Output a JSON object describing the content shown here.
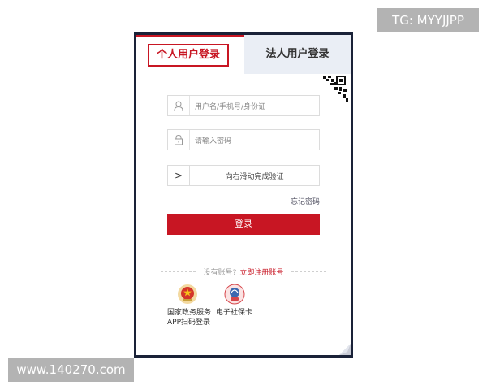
{
  "watermarks": {
    "top": "TG: MYYJJPP",
    "bottom": "www.140270.com"
  },
  "tabs": {
    "personal": "个人用户登录",
    "legal": "法人用户登录"
  },
  "form": {
    "username_placeholder": "用户名/手机号/身份证",
    "password_placeholder": "请输入密码",
    "slider_text": "向右滑动完成验证",
    "slider_handle": ">",
    "forgot_password": "忘记密码",
    "login_button": "登录"
  },
  "register": {
    "prompt": "没有账号?",
    "link": "立即注册账号"
  },
  "apps": [
    {
      "label_line1": "国家政务服务",
      "label_line2": "APP扫码登录",
      "icon": "national-emblem-icon"
    },
    {
      "label_line1": "电子社保卡",
      "label_line2": "",
      "icon": "social-security-card-icon"
    }
  ],
  "colors": {
    "accent": "#c81623",
    "panel_border": "#1a2238",
    "legal_tab_bg": "#eaeef5"
  }
}
